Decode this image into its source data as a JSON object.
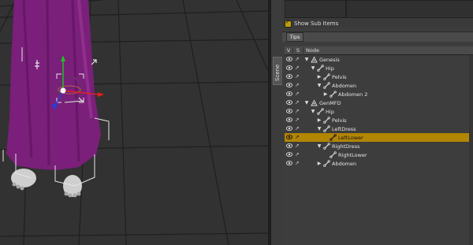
{
  "panel": {
    "show_sub_items_label": "Show Sub Items",
    "tips_tab_label": "Tips",
    "scene_tab_label": "Scene"
  },
  "columns": {
    "visible": "V",
    "selectable": "S",
    "node": "Node"
  },
  "tree": [
    {
      "label": "Genesis",
      "depth": 0,
      "expander": "down",
      "icon": "figure-icon",
      "selected": false
    },
    {
      "label": "Hip",
      "depth": 1,
      "expander": "down",
      "icon": "bone-icon",
      "selected": false
    },
    {
      "label": "Pelvis",
      "depth": 2,
      "expander": "right",
      "icon": "bone-icon",
      "selected": false
    },
    {
      "label": "Abdomen",
      "depth": 2,
      "expander": "down",
      "icon": "bone-icon",
      "selected": false
    },
    {
      "label": "Abdomen 2",
      "depth": 3,
      "expander": "right",
      "icon": "bone-icon",
      "selected": false
    },
    {
      "label": "GenMFD",
      "depth": 0,
      "expander": "down",
      "icon": "figure-icon",
      "selected": false
    },
    {
      "label": "Hip",
      "depth": 1,
      "expander": "down",
      "icon": "bone-icon",
      "selected": false
    },
    {
      "label": "Pelvis",
      "depth": 2,
      "expander": "right",
      "icon": "bone-icon",
      "selected": false
    },
    {
      "label": "LeftDress",
      "depth": 2,
      "expander": "down",
      "icon": "bone-icon",
      "selected": false
    },
    {
      "label": "LeftLower",
      "depth": 3,
      "expander": "none",
      "icon": "bone-icon",
      "selected": true
    },
    {
      "label": "RightDress",
      "depth": 2,
      "expander": "down",
      "icon": "bone-icon",
      "selected": false
    },
    {
      "label": "RightLower",
      "depth": 3,
      "expander": "none",
      "icon": "bone-icon",
      "selected": false
    },
    {
      "label": "Abdomen",
      "depth": 2,
      "expander": "right",
      "icon": "bone-icon",
      "selected": false
    }
  ],
  "colors": {
    "selection": "#b38600",
    "dress": "#7a1f7a",
    "checkbox": "#c0a000",
    "gizmo_x": "#e02020",
    "gizmo_y": "#20c020",
    "gizmo_z": "#2040e0"
  }
}
